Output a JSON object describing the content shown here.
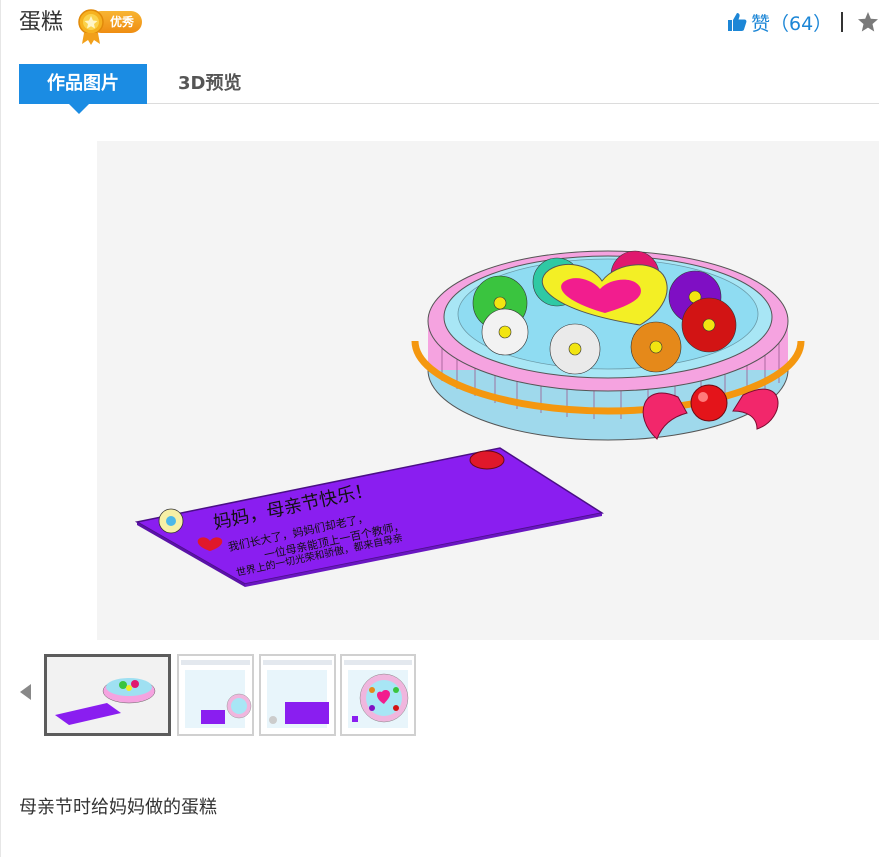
{
  "header": {
    "title": "蛋糕",
    "badge_label": "优秀",
    "like_label": "赞（64）"
  },
  "tabs": [
    {
      "label": "作品图片",
      "active": true
    },
    {
      "label": "3D预览",
      "active": false
    }
  ],
  "card": {
    "line1": "妈妈，母亲节快乐！",
    "line2": "我们长大了，妈妈们却老了，",
    "line3": "一位母亲能顶上一百个教师，",
    "line4": "世界上的一切光荣和骄傲，都来自母亲"
  },
  "thumbnails": [
    {
      "name": "thumbnail-1",
      "selected": true
    },
    {
      "name": "thumbnail-2",
      "selected": false
    },
    {
      "name": "thumbnail-3",
      "selected": false
    },
    {
      "name": "thumbnail-4",
      "selected": false
    }
  ],
  "description": "母亲节时给妈妈做的蛋糕",
  "colors": {
    "accent": "#1b8ce3",
    "badge": "#ef8d12",
    "card": "#8a1ef0"
  },
  "icons": [
    "thumbs-up-icon",
    "star-icon",
    "medal-icon",
    "chevron-left-icon"
  ]
}
